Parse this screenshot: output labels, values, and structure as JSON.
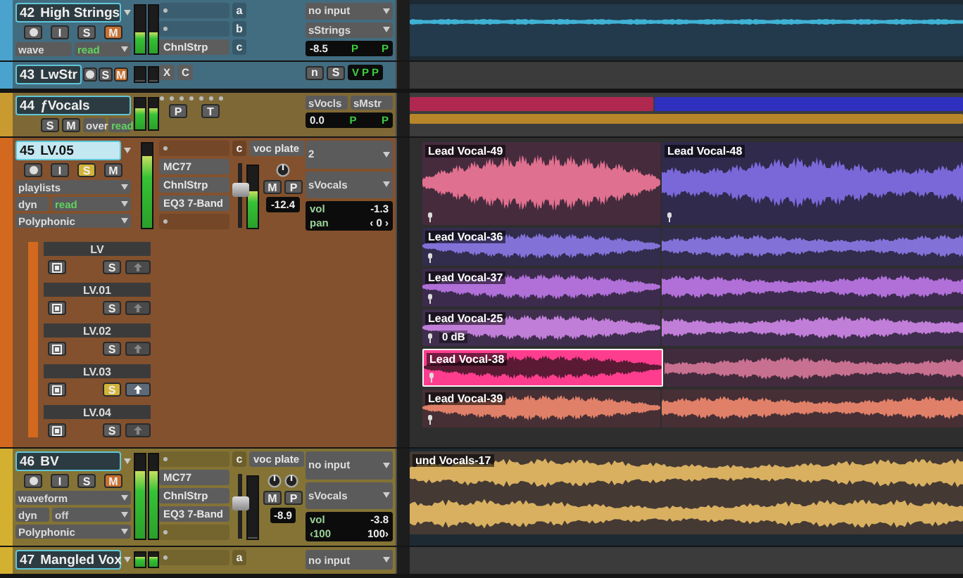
{
  "tracks": [
    {
      "number": "42",
      "name": "High Strings",
      "kind": "audio",
      "color": "#4aa3cc",
      "selected": false,
      "buttons": [
        {
          "kind": "record",
          "on": false
        },
        {
          "kind": "input",
          "label": "I",
          "on": false
        },
        {
          "kind": "solo",
          "label": "S",
          "on": false
        },
        {
          "kind": "mute",
          "label": "M",
          "on": true
        }
      ],
      "view": "wave",
      "automation": {
        "label": "read",
        "active": true
      },
      "meters": [
        {
          "level": 0.45
        },
        {
          "level": 0.45
        }
      ],
      "inserts": [
        {
          "kind": "empty"
        },
        {
          "kind": "empty"
        },
        {
          "kind": "plugin",
          "name": "ChnlStrp"
        }
      ],
      "sends": [
        {
          "letter": "a"
        },
        {
          "letter": "b"
        },
        {
          "letter": "c"
        }
      ],
      "io": {
        "input": "no input",
        "output": "sStrings"
      },
      "readout": {
        "value": "-8.5",
        "flags": [
          "P",
          "P"
        ]
      },
      "lane": [
        {
          "kind": "wave",
          "clips": [
            {
              "color": "#3fb2d4",
              "selected": false
            }
          ]
        }
      ]
    },
    {
      "number": "43",
      "name": "LwStr",
      "kind": "compact",
      "color": "#4aa3cc",
      "selected": false,
      "buttons": [
        {
          "kind": "record",
          "on": false
        },
        {
          "kind": "solo",
          "label": "S",
          "on": false
        },
        {
          "kind": "mute",
          "label": "M",
          "on": true
        }
      ],
      "meters": [
        {
          "level": 0
        },
        {
          "level": 0
        }
      ],
      "inserts": [
        {
          "kind": "plugin",
          "name": "X"
        },
        {
          "kind": "plugin",
          "name": "C"
        }
      ],
      "io_buttons": [
        "n",
        "S"
      ],
      "readout": {
        "flags": [
          "V",
          "P",
          "P"
        ]
      }
    },
    {
      "number": "44",
      "name": "ƒVocals",
      "kind": "folder",
      "color": "#c89a30",
      "selected": false,
      "buttons": [
        {
          "kind": "solo",
          "label": "S",
          "on": false
        },
        {
          "kind": "mute",
          "label": "M",
          "on": false
        }
      ],
      "view": "over",
      "automation": {
        "label": "read",
        "active": true
      },
      "meters": [
        {
          "level": 0.7
        },
        {
          "level": 0.7
        }
      ],
      "folder_buttons": [
        "P",
        "T"
      ],
      "io": {
        "input": "sVocls",
        "output": "sMstr"
      },
      "readout": {
        "value": "0.0",
        "flags": [
          "P",
          "P"
        ]
      },
      "lane": [
        {
          "kind": "bar",
          "clips": [
            {
              "color": "#b02850",
              "selected": false
            },
            {
              "color": "#3030c0",
              "selected": false
            }
          ]
        },
        {
          "kind": "bar",
          "clips": [
            {
              "color": "#b8862a",
              "selected": false
            }
          ]
        }
      ]
    },
    {
      "number": "45",
      "name": "LV.05",
      "kind": "audio",
      "color": "#d2691e",
      "selected": true,
      "buttons": [
        {
          "kind": "record",
          "on": false
        },
        {
          "kind": "input",
          "label": "I",
          "on": false
        },
        {
          "kind": "solo",
          "label": "S",
          "on": true
        },
        {
          "kind": "mute",
          "label": "M",
          "on": false
        }
      ],
      "view": "playlists",
      "dyn": "dyn",
      "automation": {
        "label": "read",
        "active": true
      },
      "elastic": "Polyphonic",
      "meters": [
        {
          "level": 0.85
        }
      ],
      "inserts": [
        {
          "kind": "empty"
        },
        {
          "kind": "plugin",
          "name": "MC77"
        },
        {
          "kind": "plugin",
          "name": "ChnlStrp"
        },
        {
          "kind": "plugin",
          "name": "EQ3 7-Band"
        },
        {
          "kind": "empty"
        }
      ],
      "sends": [
        {
          "letter": "c",
          "name": "voc plate"
        }
      ],
      "fader": {
        "level": 0.6,
        "kind": "mono",
        "meters": [
          {
            "level": 0.6
          }
        ],
        "buttons": [
          "M",
          "P"
        ],
        "reading": "-12.4"
      },
      "io": {
        "input": "2",
        "output": "sVocals"
      },
      "mix": [
        {
          "cells": [
            "vol",
            "-1.3"
          ]
        },
        {
          "cells": [
            "pan",
            "‹ 0 ›"
          ]
        }
      ],
      "playlists": [
        {
          "name": "LV",
          "solo_label": "S",
          "solo": false,
          "lifted": false
        },
        {
          "name": "LV.01",
          "solo_label": "S",
          "solo": false,
          "lifted": false
        },
        {
          "name": "LV.02",
          "solo_label": "S",
          "solo": false,
          "lifted": false
        },
        {
          "name": "LV.03",
          "solo_label": "S",
          "solo": true,
          "lifted": true
        },
        {
          "name": "LV.04",
          "solo_label": "S",
          "solo": false,
          "lifted": false
        }
      ],
      "lane": [
        {
          "kind": "wave",
          "clips": [
            {
              "name": "Lead Vocal-49",
              "color": "#e0708f",
              "selected": false
            },
            {
              "name": "Lead Vocal-48",
              "color": "#7a68d8",
              "selected": false
            }
          ]
        },
        {
          "kind": "wave",
          "clips": [
            {
              "name": "Lead Vocal-36",
              "color": "#8272d8",
              "selected": false
            },
            {
              "color": "#8272d8",
              "selected": false
            }
          ]
        },
        {
          "kind": "wave",
          "clips": [
            {
              "name": "Lead Vocal-37",
              "color": "#b070d8",
              "selected": false
            },
            {
              "color": "#b070d8",
              "selected": false
            }
          ]
        },
        {
          "kind": "wave",
          "clips": [
            {
              "name": "Lead Vocal-25",
              "color": "#c07ed8",
              "selected": false,
              "gain": "0 dB"
            },
            {
              "color": "#c07ed8",
              "selected": false
            }
          ]
        },
        {
          "kind": "wave",
          "clips": [
            {
              "name": "Lead Vocal-38",
              "color": "#ff3d8e",
              "selected": true
            },
            {
              "color": "#c87090",
              "selected": false
            }
          ]
        },
        {
          "kind": "wave",
          "clips": [
            {
              "name": "Lead Vocal-39",
              "color": "#e08068",
              "selected": false
            },
            {
              "color": "#e08068",
              "selected": false
            }
          ]
        }
      ]
    },
    {
      "number": "46",
      "name": "BV",
      "kind": "audio",
      "color": "#d4b030",
      "selected": false,
      "buttons": [
        {
          "kind": "record",
          "on": false
        },
        {
          "kind": "input",
          "label": "I",
          "on": false
        },
        {
          "kind": "solo",
          "label": "S",
          "on": false
        },
        {
          "kind": "mute",
          "label": "M",
          "on": true
        }
      ],
      "view": "waveform",
      "dyn": "dyn",
      "automation": {
        "label": "off",
        "active": false
      },
      "elastic": "Polyphonic",
      "meters": [
        {
          "level": 0.8
        },
        {
          "level": 0.8
        }
      ],
      "inserts": [
        {
          "kind": "empty"
        },
        {
          "kind": "plugin",
          "name": "MC77"
        },
        {
          "kind": "plugin",
          "name": "ChnlStrp"
        },
        {
          "kind": "plugin",
          "name": "EQ3 7-Band"
        },
        {
          "kind": "empty"
        }
      ],
      "sends": [
        {
          "letter": "c",
          "name": "voc plate"
        }
      ],
      "fader": {
        "level": 0.55,
        "kind": "stereo",
        "meters": [
          {
            "level": 0
          }
        ],
        "buttons": [
          "M",
          "P"
        ],
        "reading": "-8.9"
      },
      "io": {
        "input": "no input",
        "output": "sVocals"
      },
      "mix": [
        {
          "cells": [
            "vol",
            "-3.8"
          ]
        },
        {
          "cells": [
            "‹100",
            "100›"
          ]
        }
      ],
      "lane": [
        {
          "kind": "stereo",
          "clips": [
            {
              "name": "und Vocals-17",
              "color": "#d8b060",
              "selected": false
            }
          ]
        }
      ]
    },
    {
      "number": "47",
      "name": "Mangled Vox",
      "kind": "audio",
      "color": "#d4b030",
      "selected": false,
      "meters": [
        {
          "level": 0.7
        },
        {
          "level": 0.7
        }
      ],
      "inserts": [
        {
          "kind": "empty"
        }
      ],
      "sends": [
        {
          "letter": "a"
        }
      ],
      "io": {
        "input": "no input"
      }
    }
  ]
}
